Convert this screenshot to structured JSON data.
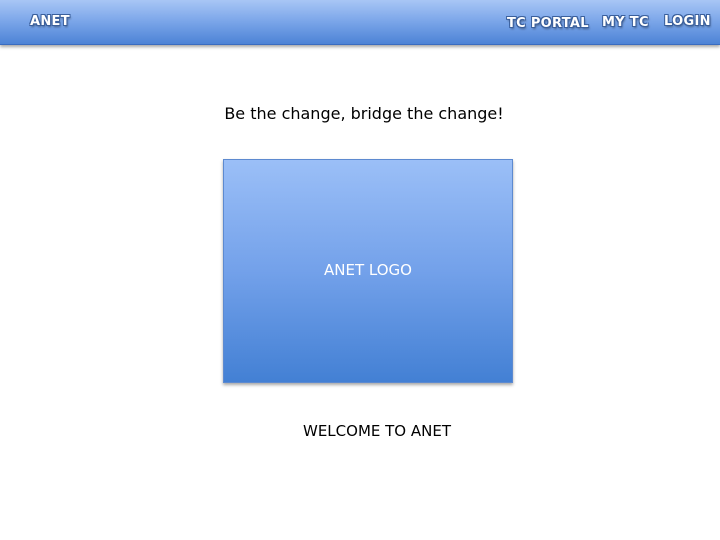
{
  "header": {
    "brand": "ANET",
    "nav": {
      "tc_portal": "TC PORTAL",
      "my_tc": "MY TC",
      "login": "LOGIN"
    }
  },
  "main": {
    "tagline": "Be the change, bridge the change!",
    "logo_placeholder": "ANET LOGO",
    "welcome": "WELCOME TO ANET"
  },
  "colors": {
    "header_top": "#a8c6f5",
    "header_bottom": "#4d83d6",
    "logo_top": "#9bbff7",
    "logo_bottom": "#4380d4"
  }
}
